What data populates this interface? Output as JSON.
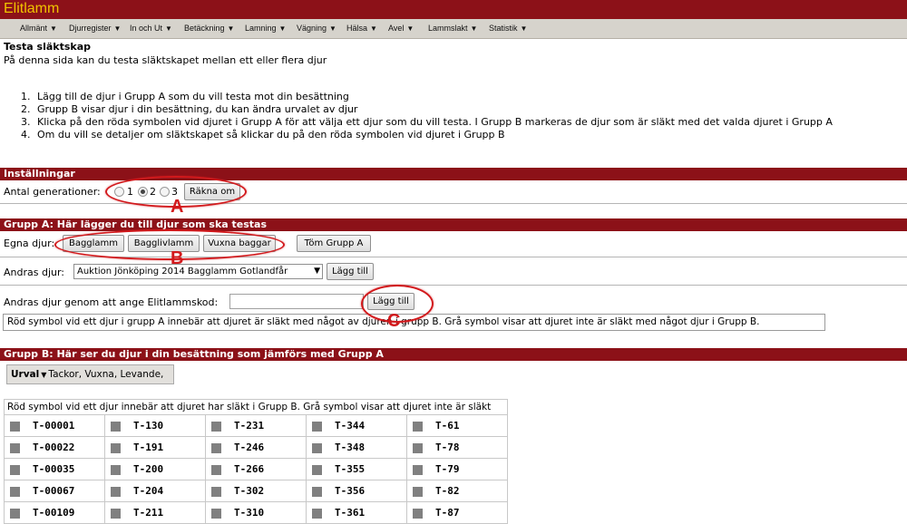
{
  "app": {
    "title": "Elitlamm"
  },
  "nav": [
    {
      "label": "Allmänt"
    },
    {
      "label": "Djurregister"
    },
    {
      "label": "In och Ut"
    },
    {
      "label": "Betäckning"
    },
    {
      "label": "Lamning"
    },
    {
      "label": "Vägning"
    },
    {
      "label": "Hälsa"
    },
    {
      "label": "Avel"
    },
    {
      "label": "Lammslakt"
    },
    {
      "label": "Statistik"
    }
  ],
  "page": {
    "title": "Testa släktskap",
    "description": "På denna sida kan du testa släktskapet mellan ett eller flera djur",
    "instructions": [
      {
        "num": "1.",
        "text": "Lägg till de djur i Grupp A som du vill testa mot din besättning"
      },
      {
        "num": "2.",
        "text": "Grupp B visar djur i din besättning, du kan ändra urvalet av djur"
      },
      {
        "num": "3.",
        "text": "Klicka på den röda symbolen vid djuret i Grupp A för att välja ett djur som du vill testa. I Grupp B markeras de djur som är släkt med det valda djuret i Grupp A"
      },
      {
        "num": "4.",
        "text": "Om du vill se detaljer om släktskapet så klickar du på den röda symbolen vid djuret i Grupp B"
      }
    ]
  },
  "settings": {
    "header": "Inställningar",
    "generations_label": "Antal generationer:",
    "options": [
      "1",
      "2",
      "3"
    ],
    "selected": "2",
    "calc_button": "Räkna om"
  },
  "group_a": {
    "header": "Grupp A: Här lägger du till djur som ska testas",
    "own_label": "Egna djur:",
    "own_buttons": [
      "Bagglamm",
      "Bagglivlamm",
      "Vuxna baggar"
    ],
    "clear_button": "Töm Grupp A",
    "others_label": "Andras djur:",
    "others_select": "Auktion Jönköping 2014 Bagglamm Gotlandfår",
    "add_button": "Lägg till",
    "code_label": "Andras djur genom att ange Elitlammskod:",
    "code_value": "",
    "code_button": "Lägg till",
    "note": "Röd symbol vid ett djur i grupp A innebär att djuret är släkt med något av djuren i grupp B. Grå symbol visar att djuret inte är släkt med något djur i Grupp B."
  },
  "group_b": {
    "header": "Grupp B: Här ser du djur i din besättning som jämförs med Grupp A",
    "urval_label": "Urval",
    "urval_value": "Tackor, Vuxna, Levande,",
    "table_header": "Röd symbol vid ett djur innebär att djuret har släkt i Grupp B. Grå symbol visar att djuret inte är släkt",
    "rows": [
      [
        "T-00001",
        "T-130",
        "T-231",
        "T-344",
        "T-61"
      ],
      [
        "T-00022",
        "T-191",
        "T-246",
        "T-348",
        "T-78"
      ],
      [
        "T-00035",
        "T-200",
        "T-266",
        "T-355",
        "T-79"
      ],
      [
        "T-00067",
        "T-204",
        "T-302",
        "T-356",
        "T-82"
      ],
      [
        "T-00109",
        "T-211",
        "T-310",
        "T-361",
        "T-87"
      ]
    ]
  },
  "annotations": {
    "a": "A",
    "b": "B",
    "c": "C"
  },
  "colors": {
    "brand_bar": "#8c1118",
    "brand_text": "#f0c300",
    "annotation": "#d2191c",
    "symbol_grey": "#808080"
  }
}
